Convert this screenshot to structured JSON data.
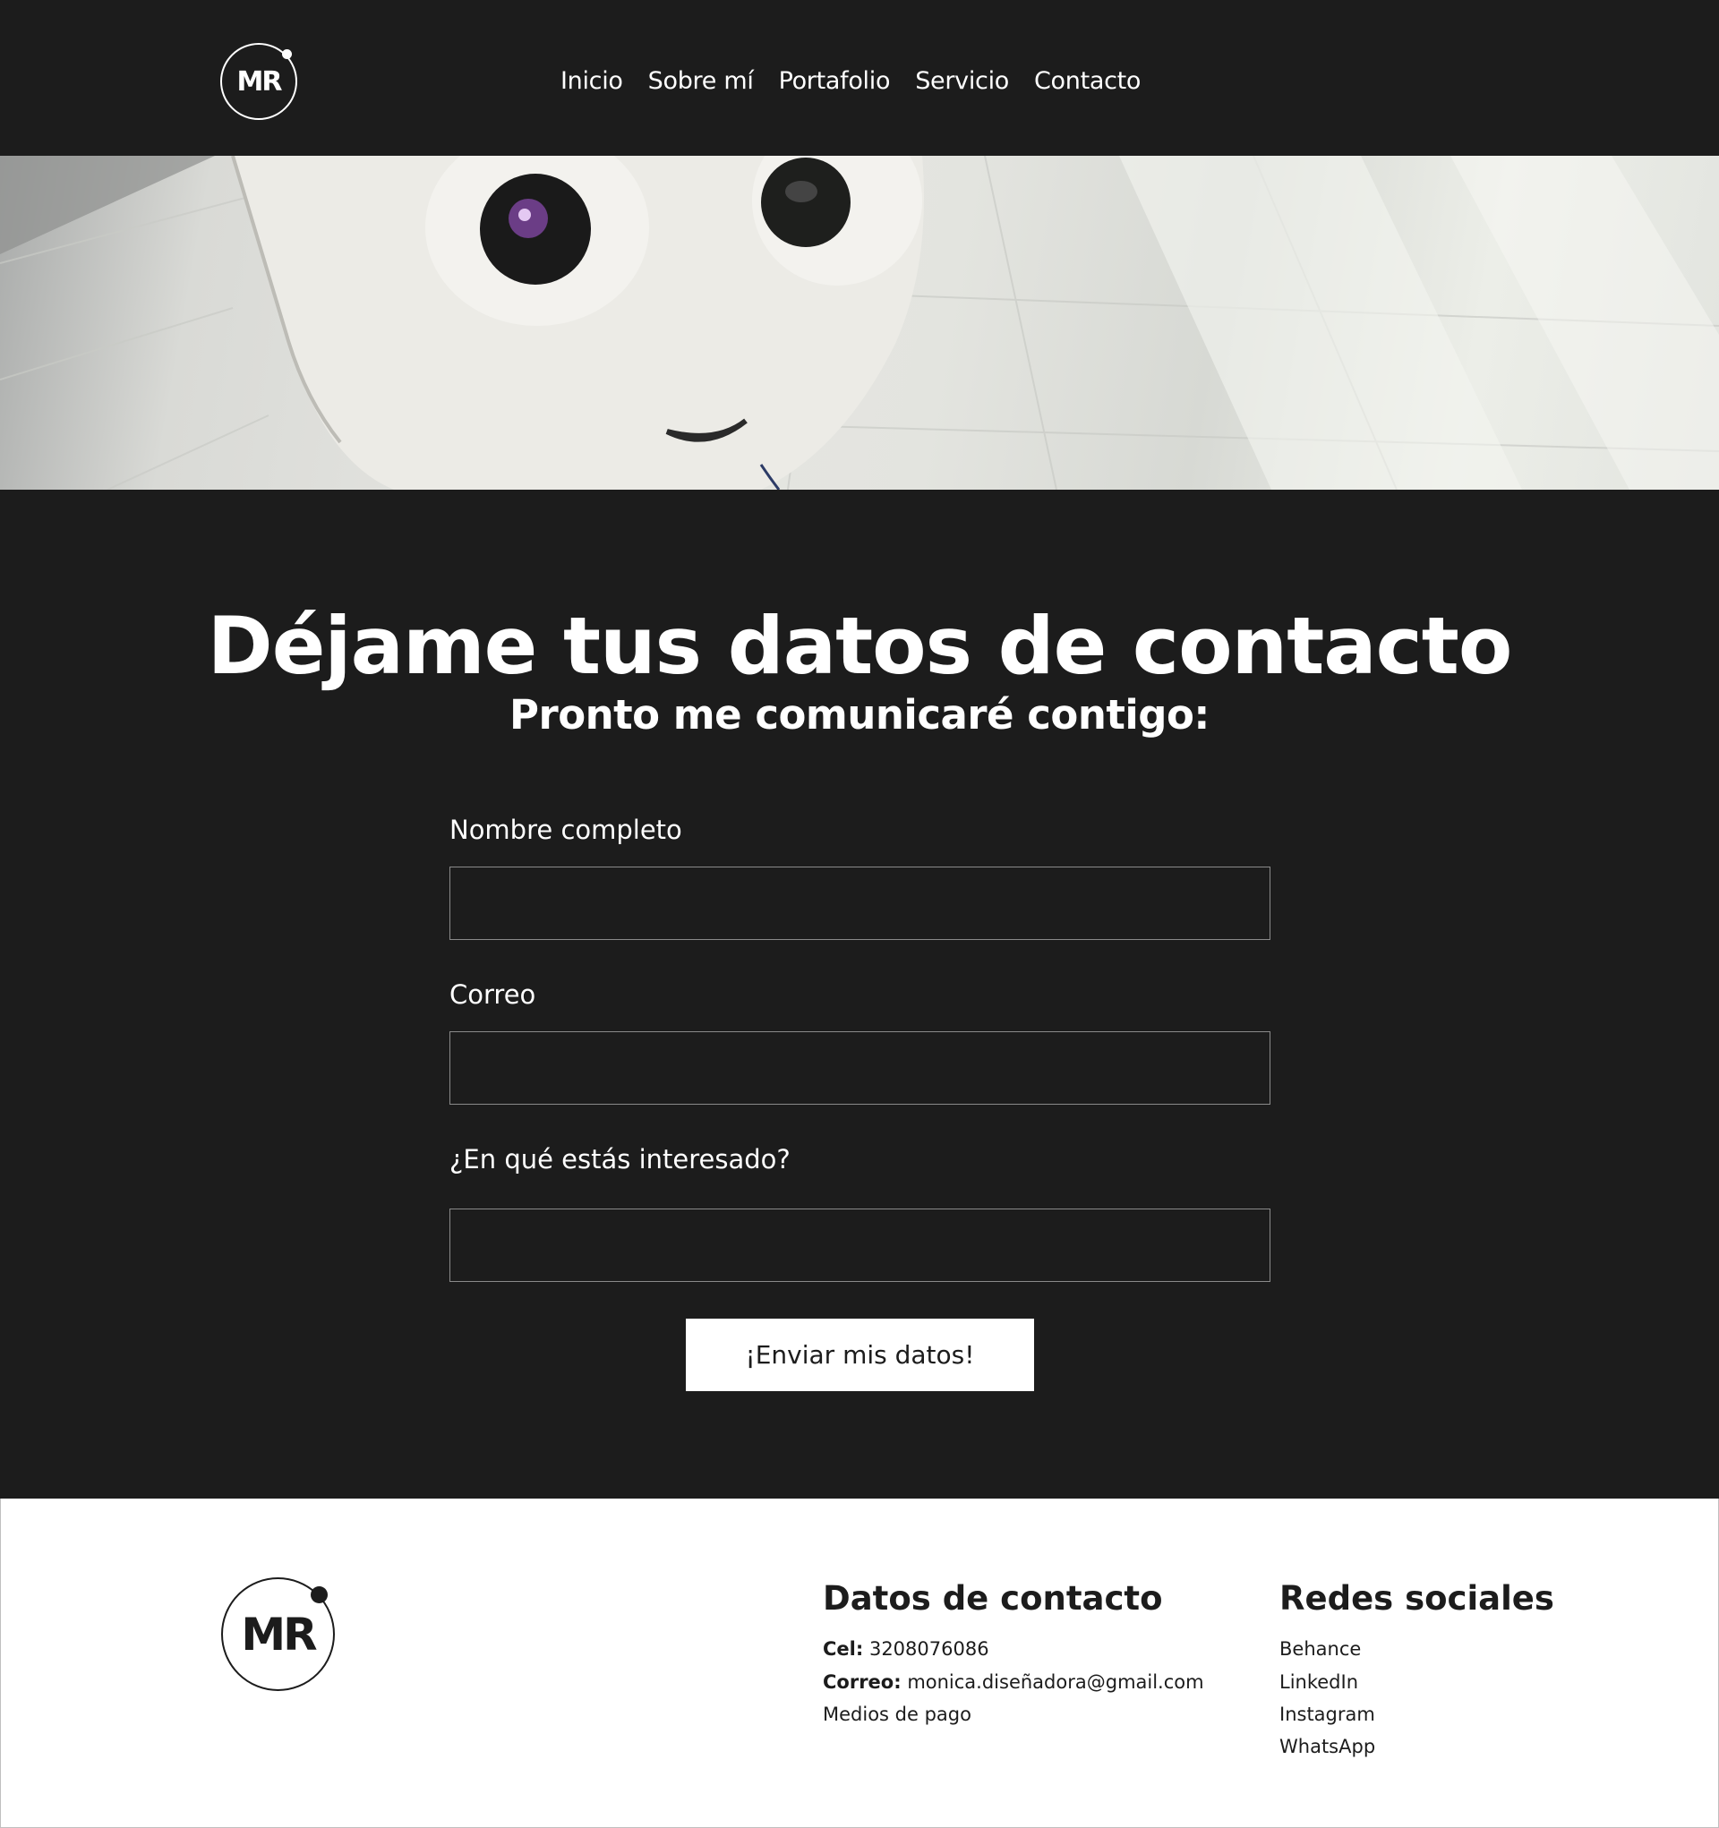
{
  "header": {
    "logo_text": "MR",
    "nav": [
      {
        "label": "Inicio"
      },
      {
        "label": "Sobre mí"
      },
      {
        "label": "Portafolio"
      },
      {
        "label": "Servicio"
      },
      {
        "label": "Contacto"
      }
    ]
  },
  "hero": {
    "image_subject": "white robot face on tiled floor"
  },
  "contact": {
    "title": "Déjame tus datos de contacto",
    "subtitle": "Pronto me comunicaré contigo:",
    "fields": [
      {
        "label": "Nombre completo",
        "value": "",
        "placeholder": ""
      },
      {
        "label": "Correo",
        "value": "",
        "placeholder": ""
      },
      {
        "label": "¿En qué estás interesado?",
        "value": "",
        "placeholder": ""
      }
    ],
    "submit_label": "¡Enviar mis datos!"
  },
  "footer": {
    "logo_text": "MR",
    "contact_title": "Datos de contacto",
    "cel_label": "Cel:",
    "cel_value": "3208076086",
    "email_label": "Correo:",
    "email_value": "monica.diseñadora@gmail.com",
    "payments": "Medios de pago",
    "social_title": "Redes sociales",
    "social": [
      {
        "label": "Behance"
      },
      {
        "label": "LinkedIn"
      },
      {
        "label": "Instagram"
      },
      {
        "label": "WhatsApp"
      }
    ]
  },
  "colors": {
    "background_dark": "#1c1c1c",
    "text_light": "#ffffff",
    "footer_bg": "#ffffff",
    "field_border": "#8a8a8a"
  }
}
